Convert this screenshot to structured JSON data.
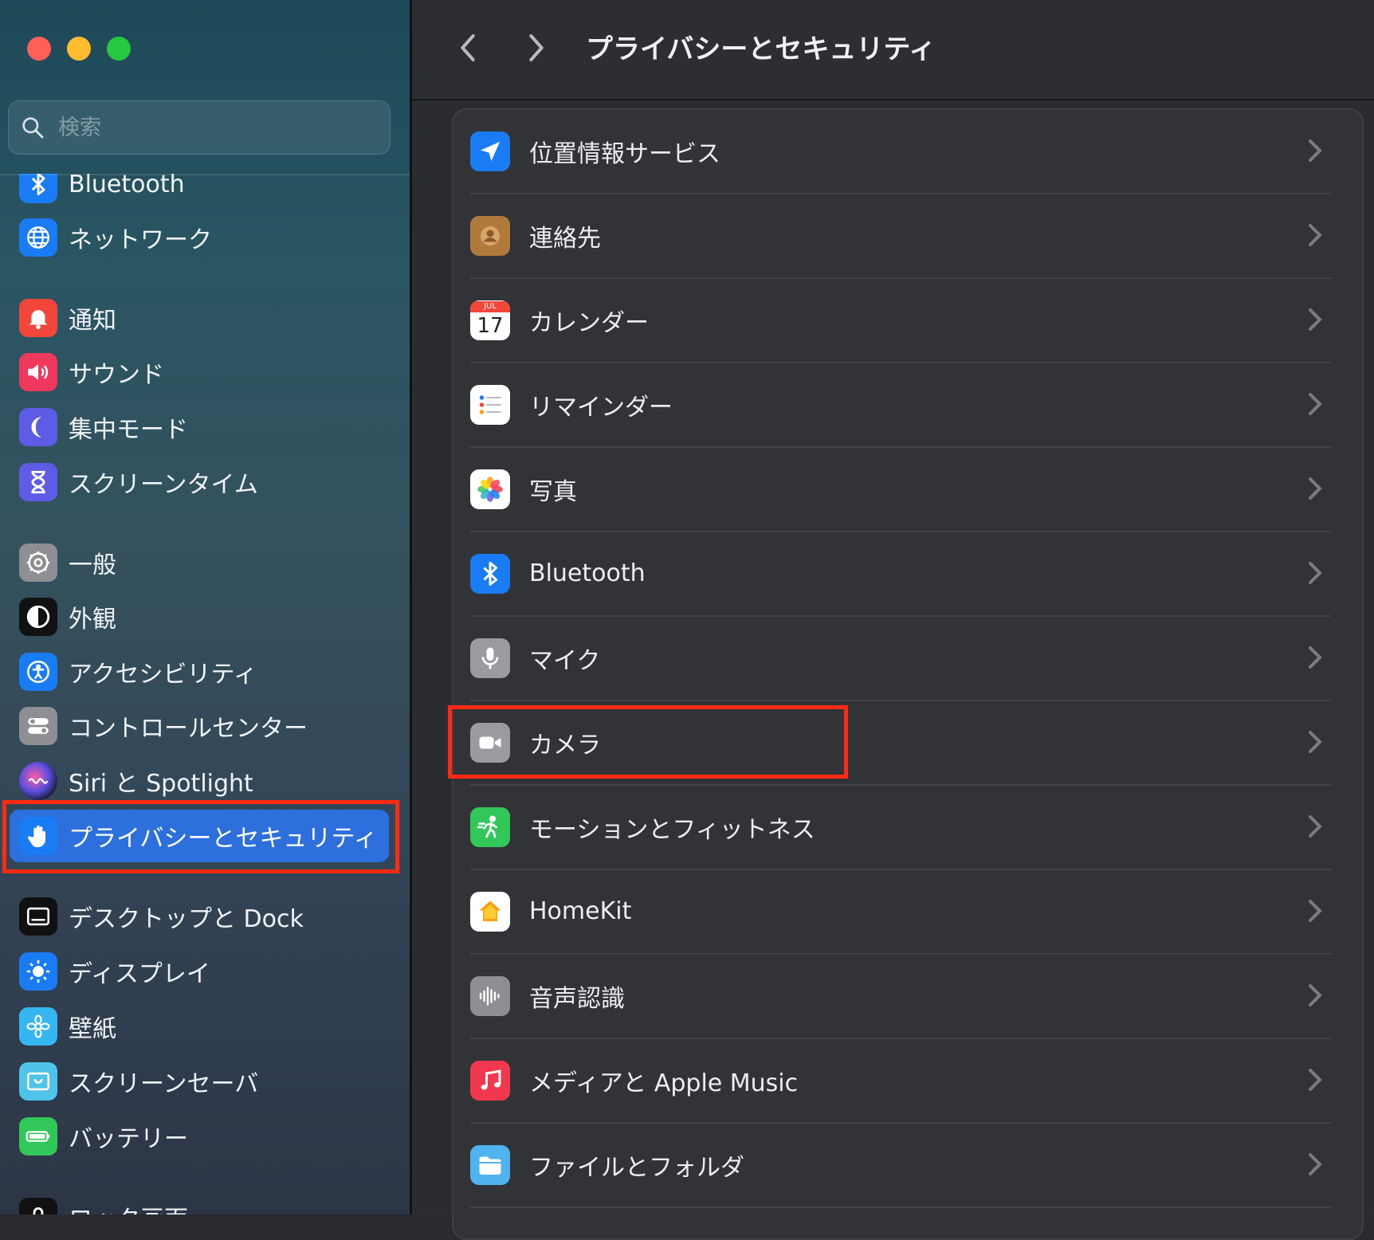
{
  "window": {
    "title": "プライバシーとセキュリティ",
    "traffic_lights": [
      "close",
      "minimize",
      "zoom"
    ]
  },
  "search": {
    "placeholder": "検索",
    "value": ""
  },
  "sidebar": {
    "items": [
      {
        "label": "Bluetooth",
        "icon": "bluetooth-icon",
        "color": "#1a7cf5"
      },
      {
        "label": "ネットワーク",
        "icon": "globe-icon",
        "color": "#1a7cf5"
      },
      {
        "label": "通知",
        "icon": "bell-icon",
        "color": "#f2463a"
      },
      {
        "label": "サウンド",
        "icon": "speaker-icon",
        "color": "#f0375d"
      },
      {
        "label": "集中モード",
        "icon": "moon-icon",
        "color": "#5e5ce6"
      },
      {
        "label": "スクリーンタイム",
        "icon": "hourglass-icon",
        "color": "#5e5ce6"
      },
      {
        "label": "一般",
        "icon": "gear-icon",
        "color": "#8e8e93"
      },
      {
        "label": "外観",
        "icon": "appearance-icon",
        "color": "#111111"
      },
      {
        "label": "アクセシビリティ",
        "icon": "accessibility-icon",
        "color": "#1a7cf5"
      },
      {
        "label": "コントロールセンター",
        "icon": "toggles-icon",
        "color": "#8e8e93"
      },
      {
        "label": "Siri と Spotlight",
        "icon": "siri-icon",
        "color": "#3a3a8c"
      },
      {
        "label": "プライバシーとセキュリティ",
        "icon": "hand-icon",
        "color": "#1a7cf5",
        "selected": true
      },
      {
        "label": "デスクトップと Dock",
        "icon": "dock-icon",
        "color": "#111111"
      },
      {
        "label": "ディスプレイ",
        "icon": "sun-icon",
        "color": "#1a7cf5"
      },
      {
        "label": "壁紙",
        "icon": "flower-icon",
        "color": "#36b6f0"
      },
      {
        "label": "スクリーンセーバ",
        "icon": "screensaver-icon",
        "color": "#4fc3e8"
      },
      {
        "label": "バッテリー",
        "icon": "battery-icon",
        "color": "#32c759"
      },
      {
        "label": "ロック画面",
        "icon": "lock-icon",
        "color": "#111111"
      }
    ]
  },
  "main": {
    "rows": [
      {
        "label": "位置情報サービス",
        "icon": "location-arrow-icon",
        "color": "#1a7cf5"
      },
      {
        "label": "連絡先",
        "icon": "contacts-icon",
        "color": "#b07a3c"
      },
      {
        "label": "カレンダー",
        "icon": "calendar-icon",
        "color": "#ffffff",
        "icon_text": "17",
        "icon_month": "JUL"
      },
      {
        "label": "リマインダー",
        "icon": "reminders-icon",
        "color": "#ffffff"
      },
      {
        "label": "写真",
        "icon": "photos-icon",
        "color": "#ffffff"
      },
      {
        "label": "Bluetooth",
        "icon": "bluetooth-icon",
        "color": "#1a7cf5"
      },
      {
        "label": "マイク",
        "icon": "microphone-icon",
        "color": "#9a9aa0"
      },
      {
        "label": "カメラ",
        "icon": "camera-icon",
        "color": "#9a9aa0",
        "highlighted": true
      },
      {
        "label": "モーションとフィットネス",
        "icon": "fitness-icon",
        "color": "#32c759"
      },
      {
        "label": "HomeKit",
        "icon": "home-icon",
        "color": "#ffffff"
      },
      {
        "label": "音声認識",
        "icon": "waveform-icon",
        "color": "#8e8e93"
      },
      {
        "label": "メディアと Apple Music",
        "icon": "music-icon",
        "color": "#f2384f"
      },
      {
        "label": "ファイルとフォルダ",
        "icon": "folder-icon",
        "color": "#4fb3f0"
      }
    ]
  }
}
